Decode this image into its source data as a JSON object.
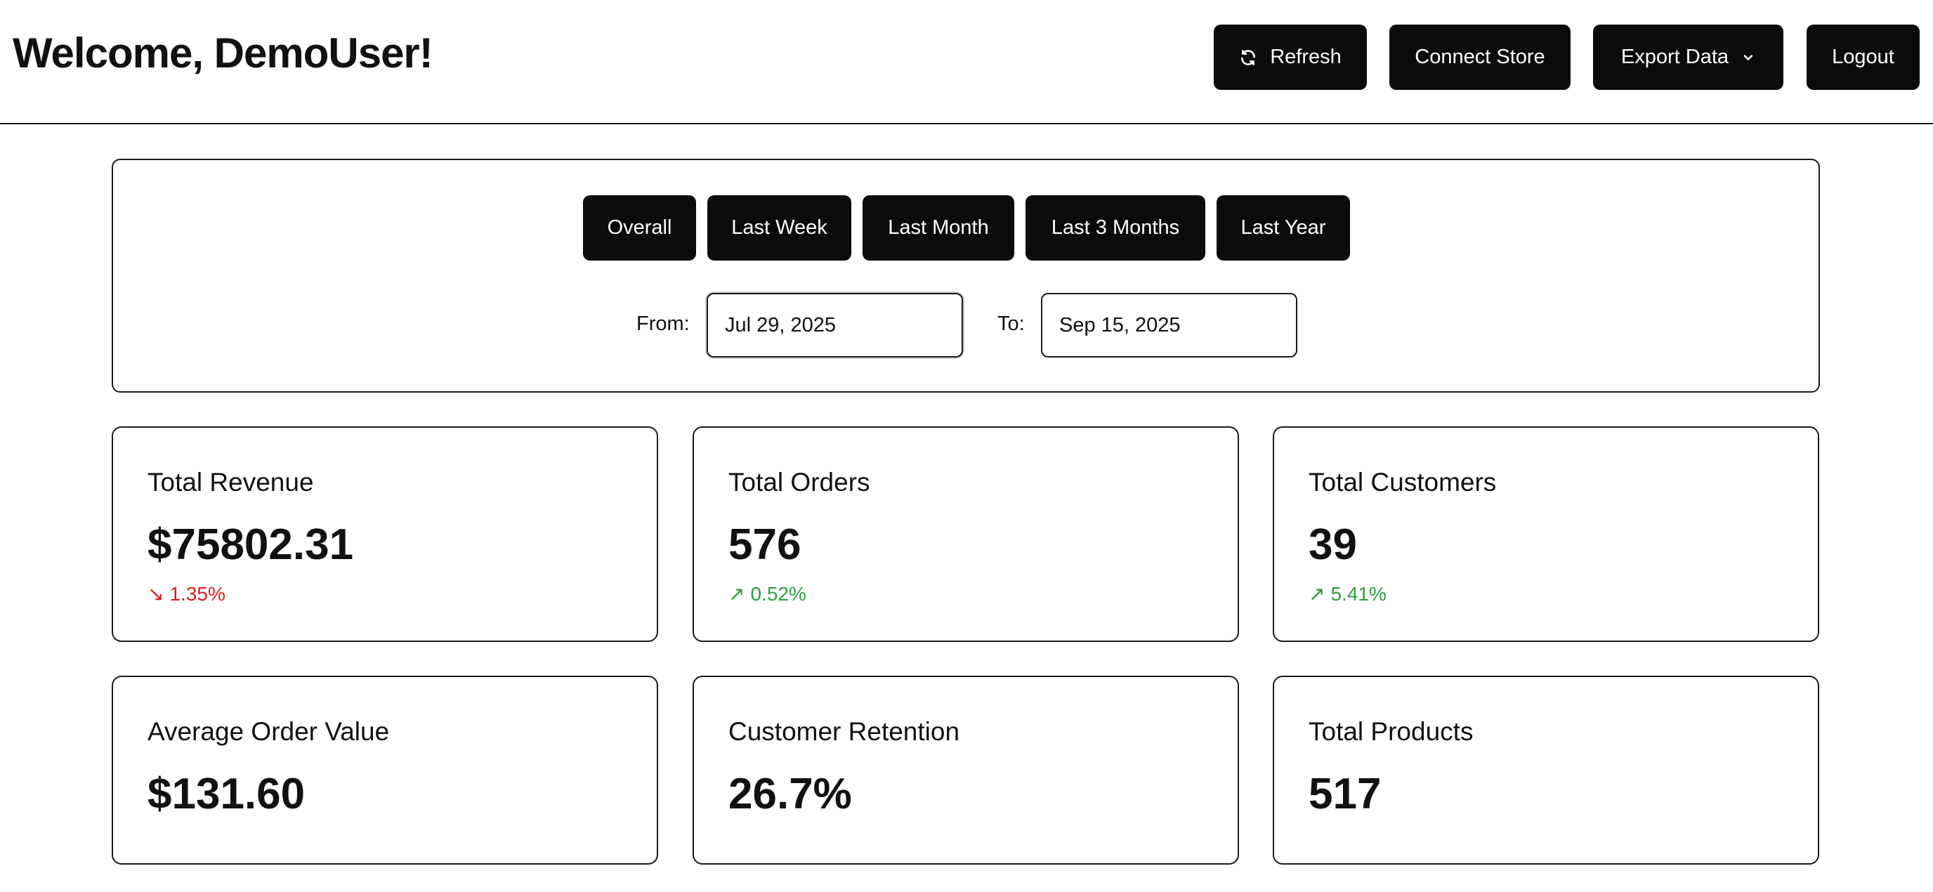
{
  "header": {
    "welcome": "Welcome, DemoUser!",
    "buttons": {
      "refresh": "Refresh",
      "connect_store": "Connect Store",
      "export_data": "Export Data",
      "logout": "Logout"
    }
  },
  "filters": {
    "periods": [
      "Overall",
      "Last Week",
      "Last Month",
      "Last 3 Months",
      "Last Year"
    ],
    "from_label": "From:",
    "from_value": "Jul 29, 2025",
    "to_label": "To:",
    "to_value": "Sep 15, 2025"
  },
  "stats": [
    {
      "title": "Total Revenue",
      "value": "$75802.31",
      "change": "1.35%",
      "direction": "down",
      "arrow": "↘"
    },
    {
      "title": "Total Orders",
      "value": "576",
      "change": "0.52%",
      "direction": "up",
      "arrow": "↗"
    },
    {
      "title": "Total Customers",
      "value": "39",
      "change": "5.41%",
      "direction": "up",
      "arrow": "↗"
    },
    {
      "title": "Average Order Value",
      "value": "$131.60"
    },
    {
      "title": "Customer Retention",
      "value": "26.7%"
    },
    {
      "title": "Total Products",
      "value": "517"
    }
  ],
  "colors": {
    "button_bg": "#0b0b0b",
    "positive": "#2e9e3e",
    "negative": "#d42020",
    "border": "#1a1a1a"
  },
  "icons": {
    "refresh": "refresh-icon",
    "export_dropdown": "chevron-down-icon"
  }
}
